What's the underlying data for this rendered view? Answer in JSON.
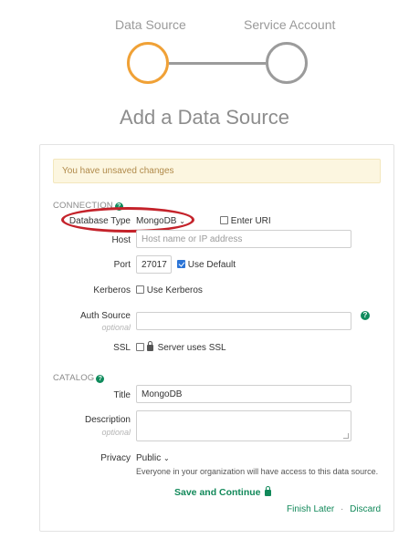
{
  "stepper": {
    "step1_label": "Data Source",
    "step2_label": "Service Account"
  },
  "page_title": "Add a Data Source",
  "alert": "You have unsaved changes",
  "connection": {
    "section_title": "CONNECTION",
    "database_type_label": "Database Type",
    "database_type_value": "MongoDB",
    "enter_uri_label": "Enter URI",
    "host_label": "Host",
    "host_placeholder": "Host name or IP address",
    "port_label": "Port",
    "port_value": "27017",
    "use_default_label": "Use Default",
    "kerberos_label": "Kerberos",
    "use_kerberos_label": "Use Kerberos",
    "auth_source_label": "Auth Source",
    "auth_source_sub": "optional",
    "auth_source_value": "",
    "ssl_label": "SSL",
    "ssl_option_label": "Server uses SSL"
  },
  "catalog": {
    "section_title": "CATALOG",
    "title_label": "Title",
    "title_value": "MongoDB",
    "description_label": "Description",
    "description_sub": "optional",
    "description_value": "",
    "privacy_label": "Privacy",
    "privacy_value": "Public",
    "privacy_note": "Everyone in your organization will have access to this data source."
  },
  "actions": {
    "save_label": "Save and Continue",
    "finish_later_label": "Finish Later",
    "separator": "·",
    "discard_label": "Discard"
  },
  "colors": {
    "accent_green": "#12895a",
    "active_step": "#f0a136",
    "inactive_step": "#9b9b9b",
    "highlight_red": "#c4222a"
  }
}
